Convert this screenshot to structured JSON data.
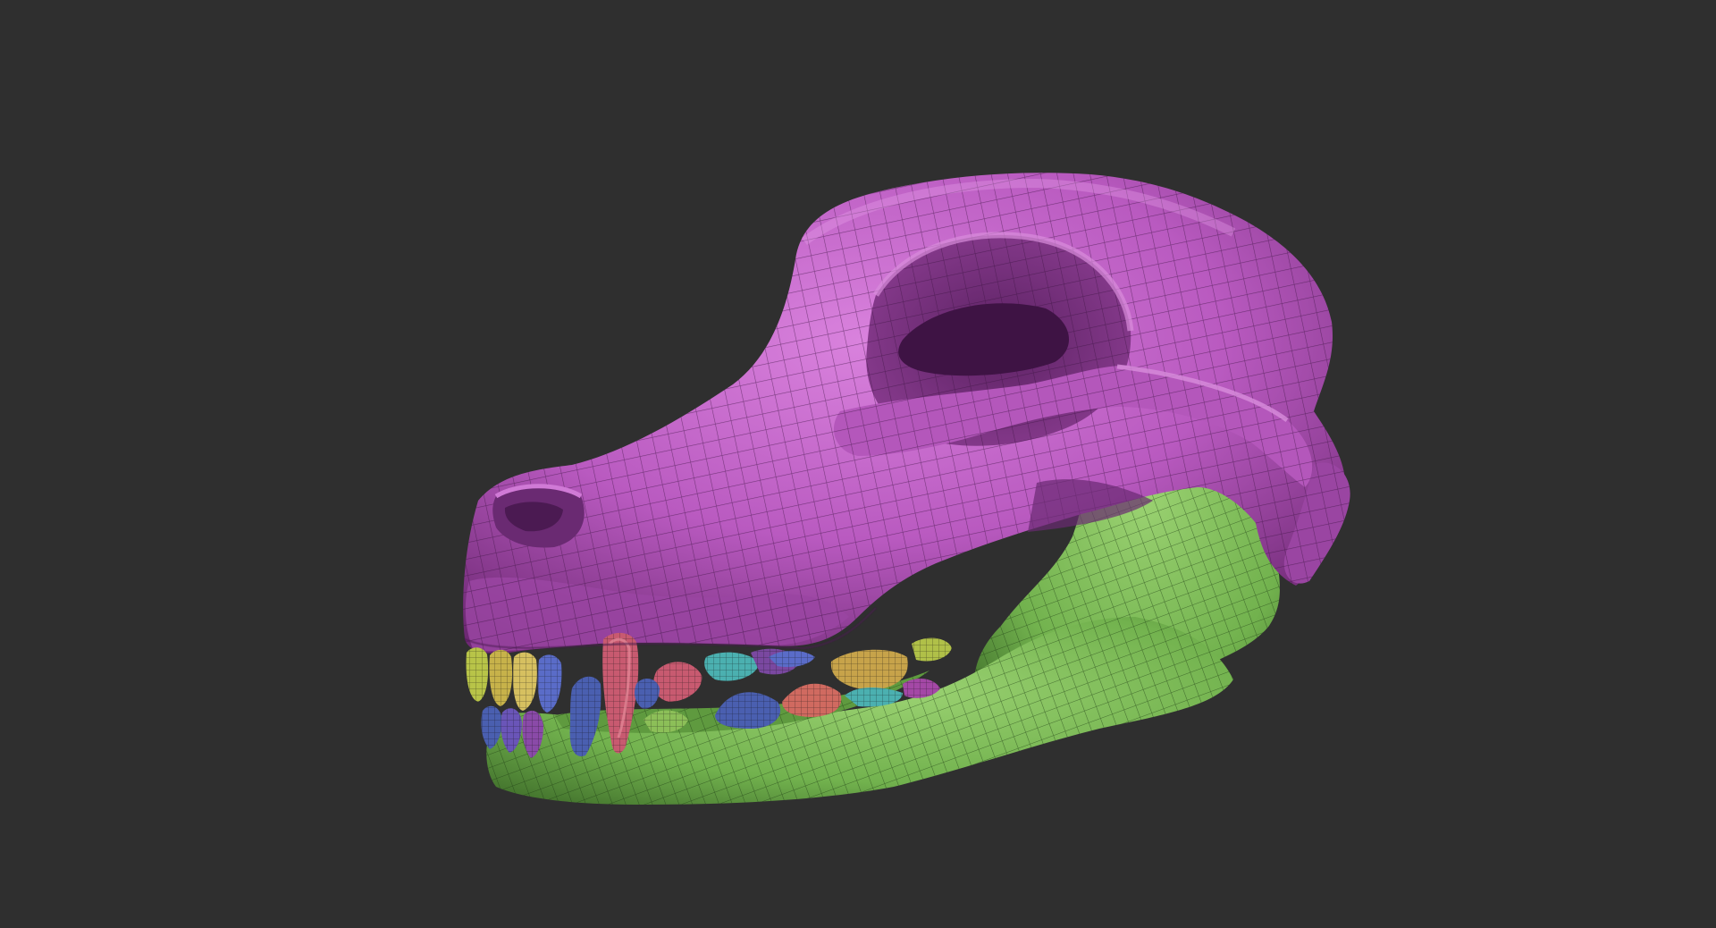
{
  "scene": {
    "subject": "dog-skull-polygroup-model",
    "background_color": "#2f2f2f",
    "colors": {
      "cranium": "#b95ac0",
      "cranium_highlight": "#d47ad8",
      "cranium_shadow": "#7a2f80",
      "mandible": "#72b24e",
      "mandible_highlight": "#96cf6a",
      "mandible_shadow": "#3e6e2a",
      "wire": "#1c1c1c",
      "teeth": [
        "#b8c448",
        "#d6c060",
        "#4a5fb0",
        "#6a55b8",
        "#c85a70",
        "#d06a60",
        "#4bb0b0",
        "#7a48a0",
        "#c7a34a",
        "#5a6cc8"
      ]
    }
  }
}
